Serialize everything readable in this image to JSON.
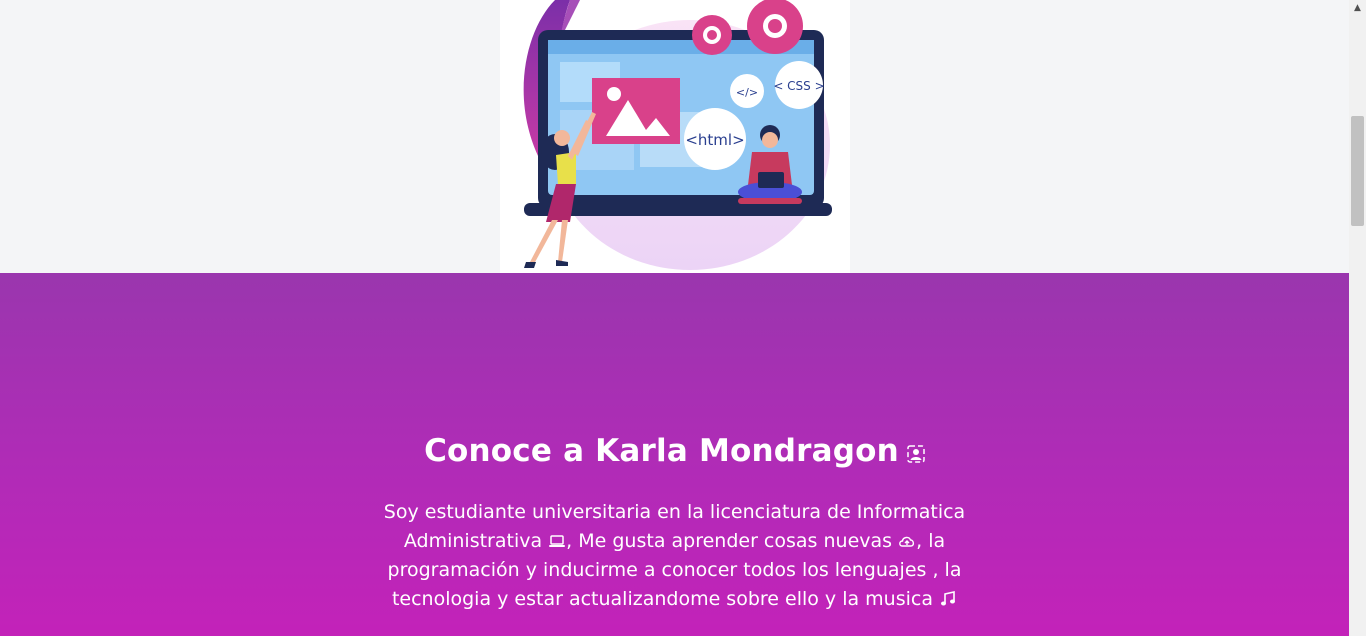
{
  "hero": {
    "illustration": {
      "tags": [
        "</>",
        "< CSS >",
        "<html>"
      ]
    }
  },
  "about": {
    "title": "Conoce a Karla Mondragon",
    "title_icon": "person-badge-icon",
    "text": {
      "part1": "Soy estudiante universitaria en la licenciatura de Informatica Administrativa",
      "icon1": "laptop-icon",
      "part2": ", Me gusta aprender cosas nuevas",
      "icon2": "cloud-upload-icon",
      "part3": ", la programación y inducirme a conocer todos los lenguajes , la tecnologia y estar actualizandome sobre ello y la musica",
      "icon3": "music-note-icon"
    }
  },
  "colors": {
    "gradient_top": "#9a36ae",
    "gradient_bottom": "#c322b9",
    "page_bg": "#f4f5f7"
  }
}
